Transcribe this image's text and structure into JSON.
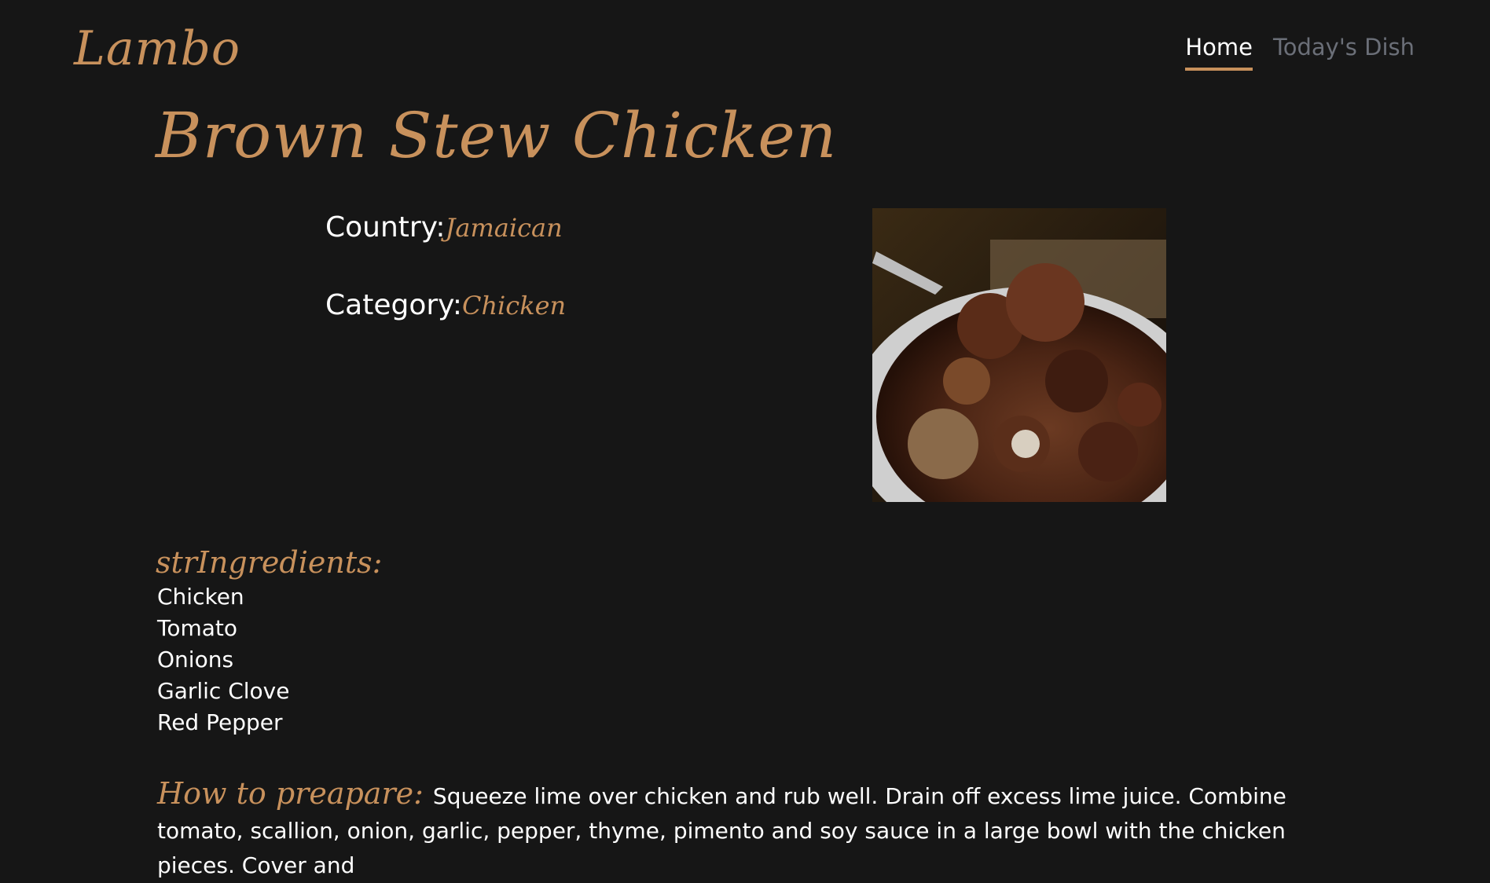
{
  "header": {
    "logo": "Lambo",
    "nav": [
      {
        "label": "Home",
        "active": true
      },
      {
        "label": "Today's Dish",
        "active": false
      }
    ]
  },
  "recipe": {
    "title": "Brown Stew Chicken",
    "country_label": "Country:",
    "country": "Jamaican",
    "category_label": "Category:",
    "category": "Chicken",
    "image_alt": "brown stew chicken in a white bowl",
    "ingredients_title": "strIngredients:",
    "ingredients": [
      "Chicken",
      "Tomato",
      "Onions",
      "Garlic Clove",
      "Red Pepper"
    ],
    "prepare_label": "How to preapare:",
    "instructions": "Squeeze lime over chicken and rub well. Drain off excess lime juice. Combine tomato, scallion, onion, garlic, pepper, thyme, pimento and soy sauce in a large bowl with the chicken pieces. Cover and"
  },
  "colors": {
    "background": "#161616",
    "accent": "#c8915c",
    "text": "#ffffff",
    "nav_inactive": "#6b6f78"
  }
}
